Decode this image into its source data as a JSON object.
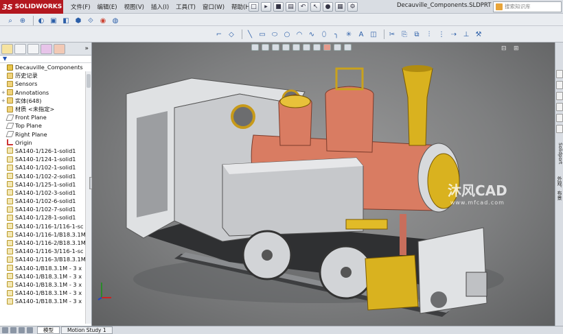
{
  "app": {
    "brand_prefix": "3S",
    "brand": "SOLIDWORKS"
  },
  "menu": [
    "文件(F)",
    "编辑(E)",
    "视图(V)",
    "插入(I)",
    "工具(T)",
    "窗口(W)",
    "帮助(H)"
  ],
  "document_title": "Decauville_Components.SLDPRT *",
  "search": {
    "placeholder": "搜索知识库"
  },
  "feature_tree": {
    "filter_icon": "filter-icon",
    "root": "Decauville_Components",
    "items": [
      {
        "label": "历史记录",
        "icon": "history"
      },
      {
        "label": "Sensors",
        "icon": "folder"
      },
      {
        "label": "Annotations",
        "icon": "annotation"
      },
      {
        "label": "实体(648)",
        "icon": "folder"
      },
      {
        "label": "材质 <未指定>",
        "icon": "material"
      },
      {
        "label": "Front Plane",
        "icon": "plane"
      },
      {
        "label": "Top Plane",
        "icon": "plane"
      },
      {
        "label": "Right Plane",
        "icon": "plane"
      },
      {
        "label": "Origin",
        "icon": "origin"
      },
      {
        "label": "SA140-1/126-1-solid1",
        "icon": "part"
      },
      {
        "label": "SA140-1/124-1-solid1",
        "icon": "part"
      },
      {
        "label": "SA140-1/102-1-solid1",
        "icon": "part"
      },
      {
        "label": "SA140-1/102-2-solid1",
        "icon": "part"
      },
      {
        "label": "SA140-1/125-1-solid1",
        "icon": "part"
      },
      {
        "label": "SA140-1/102-3-solid1",
        "icon": "part"
      },
      {
        "label": "SA140-1/102-6-solid1",
        "icon": "part"
      },
      {
        "label": "SA140-1/102-7-solid1",
        "icon": "part"
      },
      {
        "label": "SA140-1/128-1-solid1",
        "icon": "part"
      },
      {
        "label": "SA140-1/116-1/116-1-sc",
        "icon": "part"
      },
      {
        "label": "SA140-1/116-1/B18.3.1M",
        "icon": "part"
      },
      {
        "label": "SA140-1/116-2/B18.3.1M",
        "icon": "part"
      },
      {
        "label": "SA140-1/116-3/116-1-sc",
        "icon": "part"
      },
      {
        "label": "SA140-1/116-3/B18.3.1M",
        "icon": "part"
      },
      {
        "label": "SA140-1/B18.3.1M - 3 x",
        "icon": "part"
      },
      {
        "label": "SA140-1/B18.3.1M - 3 x",
        "icon": "part"
      },
      {
        "label": "SA140-1/B18.3.1M - 3 x",
        "icon": "part"
      },
      {
        "label": "SA140-1/B18.3.1M - 3 x",
        "icon": "part"
      },
      {
        "label": "SA140-1/B18.3.1M - 3 x",
        "icon": "part"
      }
    ]
  },
  "task_pane": {
    "labels": [
      "Solidport",
      "外观、布景"
    ]
  },
  "bottom_tabs": [
    "模型",
    "Motion Study 1"
  ],
  "watermark": {
    "text": "沐风CAD",
    "url": "www.mfcad.com"
  },
  "colors": {
    "brand_red": "#b3171f",
    "boiler": "#d77b63",
    "brass": "#d9b21f",
    "frame": "#d7d9dc"
  }
}
